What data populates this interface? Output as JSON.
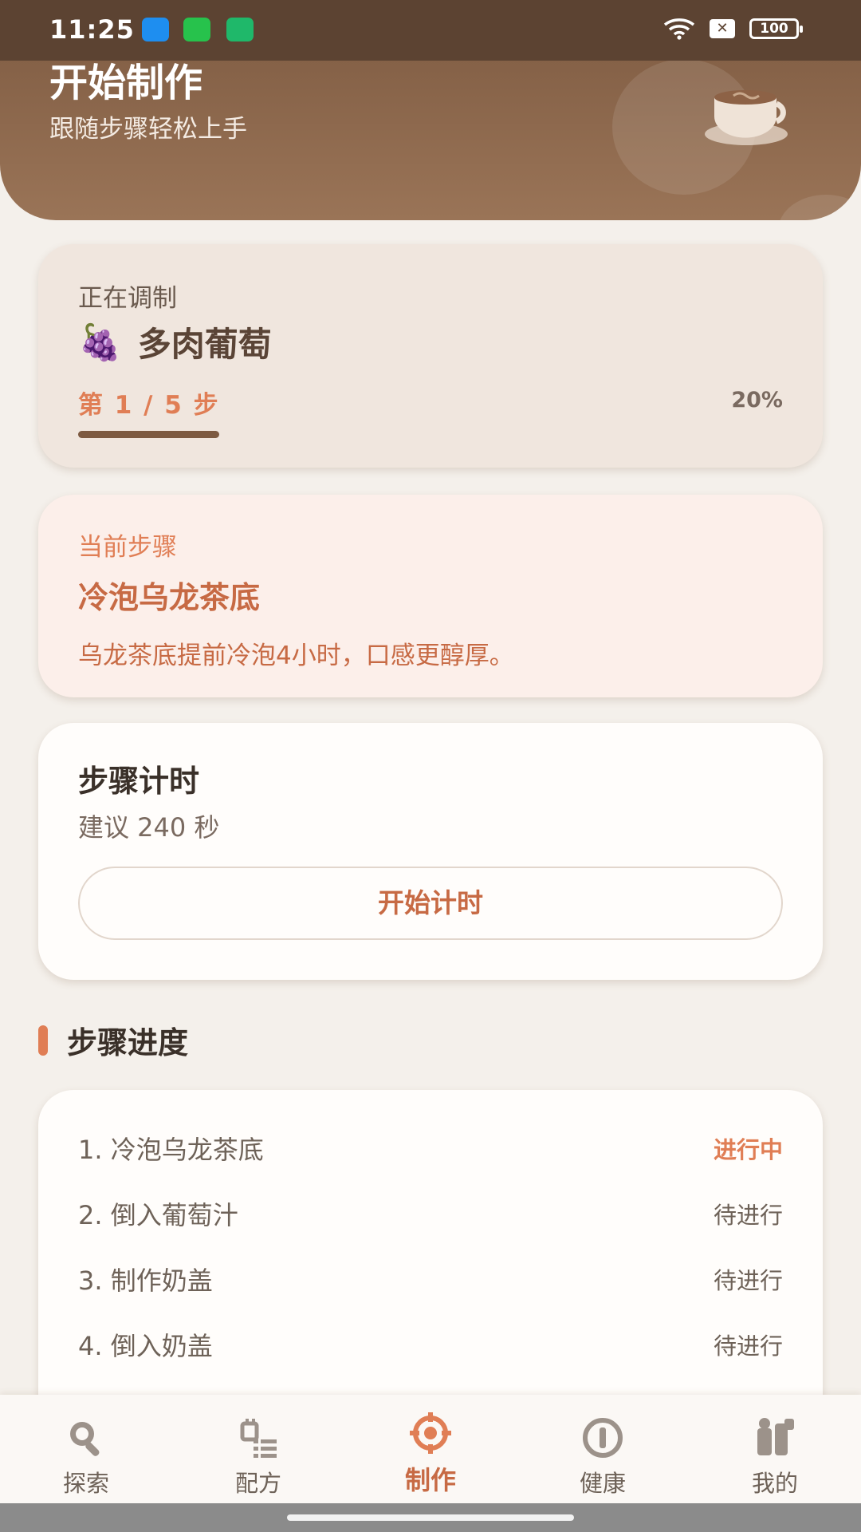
{
  "status_bar": {
    "time": "11:25",
    "battery": "100",
    "sim_badge": "✕",
    "app_colors": [
      "#1e8ef0",
      "#27c24c",
      "#1fb86a"
    ]
  },
  "header": {
    "title": "开始制作",
    "subtitle": "跟随步骤轻松上手",
    "icon": "coffee-cup-icon"
  },
  "brewing": {
    "label": "正在调制",
    "emoji": "🍇",
    "drink_name": "多肉葡萄",
    "step_text": "第 1 / 5 步",
    "percent_text": "20%",
    "progress": 0.2
  },
  "current_step": {
    "label": "当前步骤",
    "title": "冷泡乌龙茶底",
    "description": "乌龙茶底提前冷泡4小时，口感更醇厚。"
  },
  "timer": {
    "title": "步骤计时",
    "hint": "建议 240 秒",
    "button_label": "开始计时"
  },
  "progress_section": {
    "title": "步骤进度",
    "steps": [
      {
        "name": "1. 冷泡乌龙茶底",
        "status": "进行中",
        "active": true
      },
      {
        "name": "2. 倒入葡萄汁",
        "status": "待进行",
        "active": false
      },
      {
        "name": "3. 制作奶盖",
        "status": "待进行",
        "active": false
      },
      {
        "name": "4. 倒入奶盖",
        "status": "待进行",
        "active": false
      }
    ]
  },
  "nav": {
    "items": [
      {
        "label": "探索",
        "icon": "search-icon"
      },
      {
        "label": "配方",
        "icon": "recipe-icon"
      },
      {
        "label": "制作",
        "icon": "make-icon",
        "active": true
      },
      {
        "label": "健康",
        "icon": "health-icon"
      },
      {
        "label": "我的",
        "icon": "profile-icon"
      }
    ]
  },
  "colors": {
    "brand_brown": "#7d5a41",
    "accent_orange": "#e07e55",
    "background": "#f4f0eb"
  }
}
